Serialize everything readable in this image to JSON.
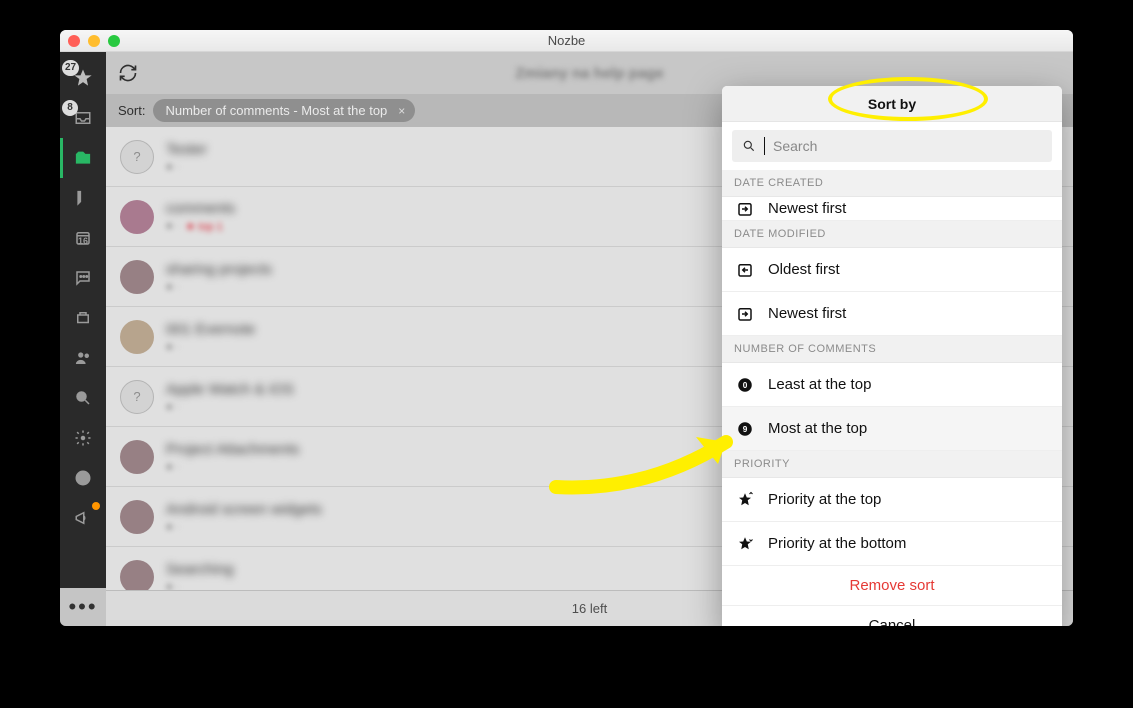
{
  "window": {
    "title": "Nozbe"
  },
  "sidebar": {
    "star_badge": "27",
    "inbox_badge": "8",
    "calendar_day": "16"
  },
  "main": {
    "title": "Zmiany na help page",
    "sort_label": "Sort:",
    "sort_chip": "Number of comments - Most at the top",
    "footer": "16 left",
    "tasks": [
      {
        "title": "Tester",
        "avatar": "q"
      },
      {
        "title": "comments",
        "avatar": "a1",
        "red": "★ top 1"
      },
      {
        "title": "sharing projects",
        "avatar": "a3"
      },
      {
        "title": "001 Evernote",
        "avatar": "a2"
      },
      {
        "title": "Apple Watch & iOS",
        "avatar": "q"
      },
      {
        "title": "Project Attachments",
        "avatar": "a3"
      },
      {
        "title": "Android screen widgets",
        "avatar": "a3"
      },
      {
        "title": "Searching",
        "avatar": "a3"
      }
    ]
  },
  "popup": {
    "title": "Sort by",
    "search_placeholder": "Search",
    "sections": {
      "date_created": "DATE CREATED",
      "date_modified": "DATE MODIFIED",
      "number_of_comments": "NUMBER OF COMMENTS",
      "priority": "PRIORITY"
    },
    "options": {
      "dc_newest": "Newest first",
      "dm_oldest": "Oldest first",
      "dm_newest": "Newest first",
      "nc_least": "Least at the top",
      "nc_most": "Most at the top",
      "pr_top": "Priority at the top",
      "pr_bottom": "Priority at the bottom"
    },
    "remove": "Remove sort",
    "cancel": "Cancel"
  }
}
